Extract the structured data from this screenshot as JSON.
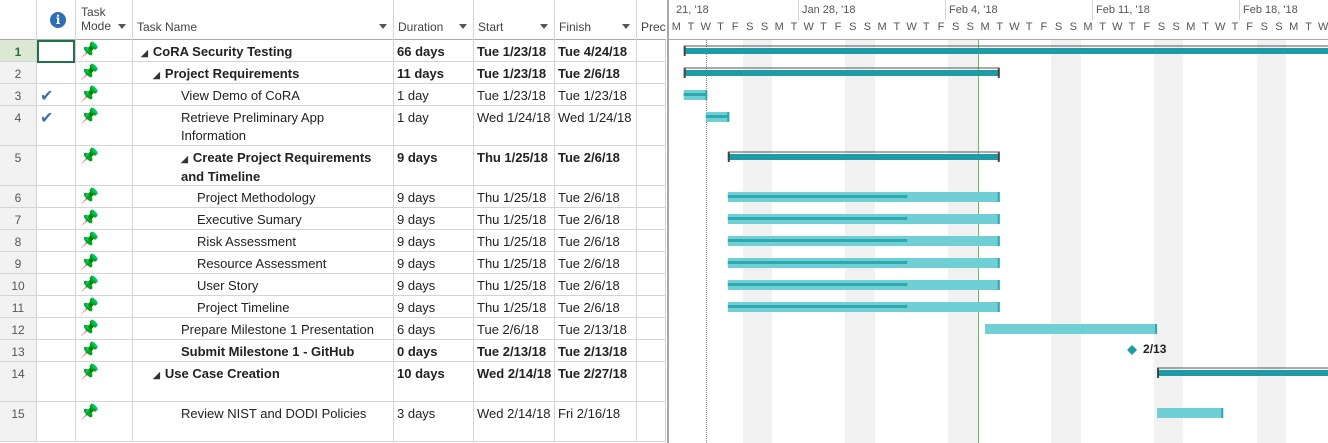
{
  "headers": {
    "info": "i",
    "task_mode_line1": "Task",
    "task_mode_line2": "Mode",
    "task_name": "Task Name",
    "duration": "Duration",
    "start": "Start",
    "finish": "Finish",
    "pred": "Prec"
  },
  "timescale": {
    "weeks": [
      "21, '18",
      "Jan 28, '18",
      "Feb 4, '18",
      "Feb 11, '18",
      "Feb 18, '18"
    ],
    "days": [
      "M",
      "T",
      "W",
      "T",
      "F",
      "S",
      "S",
      "M",
      "T",
      "W",
      "T",
      "F",
      "S",
      "S",
      "M",
      "T",
      "W",
      "T",
      "F",
      "S",
      "S",
      "M",
      "T",
      "W",
      "T",
      "F",
      "S",
      "S",
      "M",
      "T",
      "W",
      "T",
      "F",
      "S",
      "S",
      "M",
      "T",
      "W",
      "T",
      "F",
      "S",
      "S",
      "M",
      "T",
      "W"
    ]
  },
  "rows": [
    {
      "id": "1",
      "check": false,
      "name": "CoRA Security Testing",
      "summary": true,
      "indent": 0,
      "duration": "66 days",
      "start": "Tue 1/23/18",
      "finish": "Tue 4/24/18"
    },
    {
      "id": "2",
      "check": false,
      "name": "Project Requirements",
      "summary": true,
      "indent": 1,
      "duration": "11 days",
      "start": "Tue 1/23/18",
      "finish": "Tue 2/6/18"
    },
    {
      "id": "3",
      "check": true,
      "name": "View Demo of CoRA",
      "summary": false,
      "indent": 2,
      "duration": "1 day",
      "start": "Tue 1/23/18",
      "finish": "Tue 1/23/18"
    },
    {
      "id": "4",
      "check": true,
      "name": "Retrieve Preliminary App Information",
      "summary": false,
      "indent": 2,
      "duration": "1 day",
      "start": "Wed 1/24/18",
      "finish": "Wed 1/24/18"
    },
    {
      "id": "5",
      "check": false,
      "name": "Create Project Requirements and Timeline",
      "summary": true,
      "indent": 2,
      "duration": "9 days",
      "start": "Thu 1/25/18",
      "finish": "Tue 2/6/18"
    },
    {
      "id": "6",
      "check": false,
      "name": "Project Methodology",
      "summary": false,
      "indent": 3,
      "duration": "9 days",
      "start": "Thu 1/25/18",
      "finish": "Tue 2/6/18"
    },
    {
      "id": "7",
      "check": false,
      "name": "Executive Sumary",
      "summary": false,
      "indent": 3,
      "duration": "9 days",
      "start": "Thu 1/25/18",
      "finish": "Tue 2/6/18"
    },
    {
      "id": "8",
      "check": false,
      "name": "Risk Assessment",
      "summary": false,
      "indent": 3,
      "duration": "9 days",
      "start": "Thu 1/25/18",
      "finish": "Tue 2/6/18"
    },
    {
      "id": "9",
      "check": false,
      "name": "Resource Assessment",
      "summary": false,
      "indent": 3,
      "duration": "9 days",
      "start": "Thu 1/25/18",
      "finish": "Tue 2/6/18"
    },
    {
      "id": "10",
      "check": false,
      "name": "User Story",
      "summary": false,
      "indent": 3,
      "duration": "9 days",
      "start": "Thu 1/25/18",
      "finish": "Tue 2/6/18"
    },
    {
      "id": "11",
      "check": false,
      "name": "Project Timeline",
      "summary": false,
      "indent": 3,
      "duration": "9 days",
      "start": "Thu 1/25/18",
      "finish": "Tue 2/6/18"
    },
    {
      "id": "12",
      "check": false,
      "name": "Prepare Milestone 1 Presentation",
      "summary": false,
      "indent": 2,
      "duration": "6 days",
      "start": "Tue 2/6/18",
      "finish": "Tue 2/13/18"
    },
    {
      "id": "13",
      "check": false,
      "name": "Submit Milestone 1 - GitHub",
      "summary": true,
      "indent": 2,
      "duration": "0 days",
      "start": "Tue 2/13/18",
      "finish": "Tue 2/13/18"
    },
    {
      "id": "14",
      "check": false,
      "name": "Use Case Creation",
      "summary": true,
      "indent": 1,
      "duration": "10 days",
      "start": "Wed 2/14/18",
      "finish": "Tue 2/27/18"
    },
    {
      "id": "15",
      "check": false,
      "name": "Review NIST and DODI Policies",
      "summary": false,
      "indent": 2,
      "duration": "3 days",
      "start": "Wed 2/14/18",
      "finish": "Fri 2/16/18"
    }
  ],
  "milestone_label": "2/13",
  "colors": {
    "summary": "#1f9ba5",
    "task": "#6fcfd4",
    "progress": "#2ea9b0",
    "selection": "#217346"
  }
}
